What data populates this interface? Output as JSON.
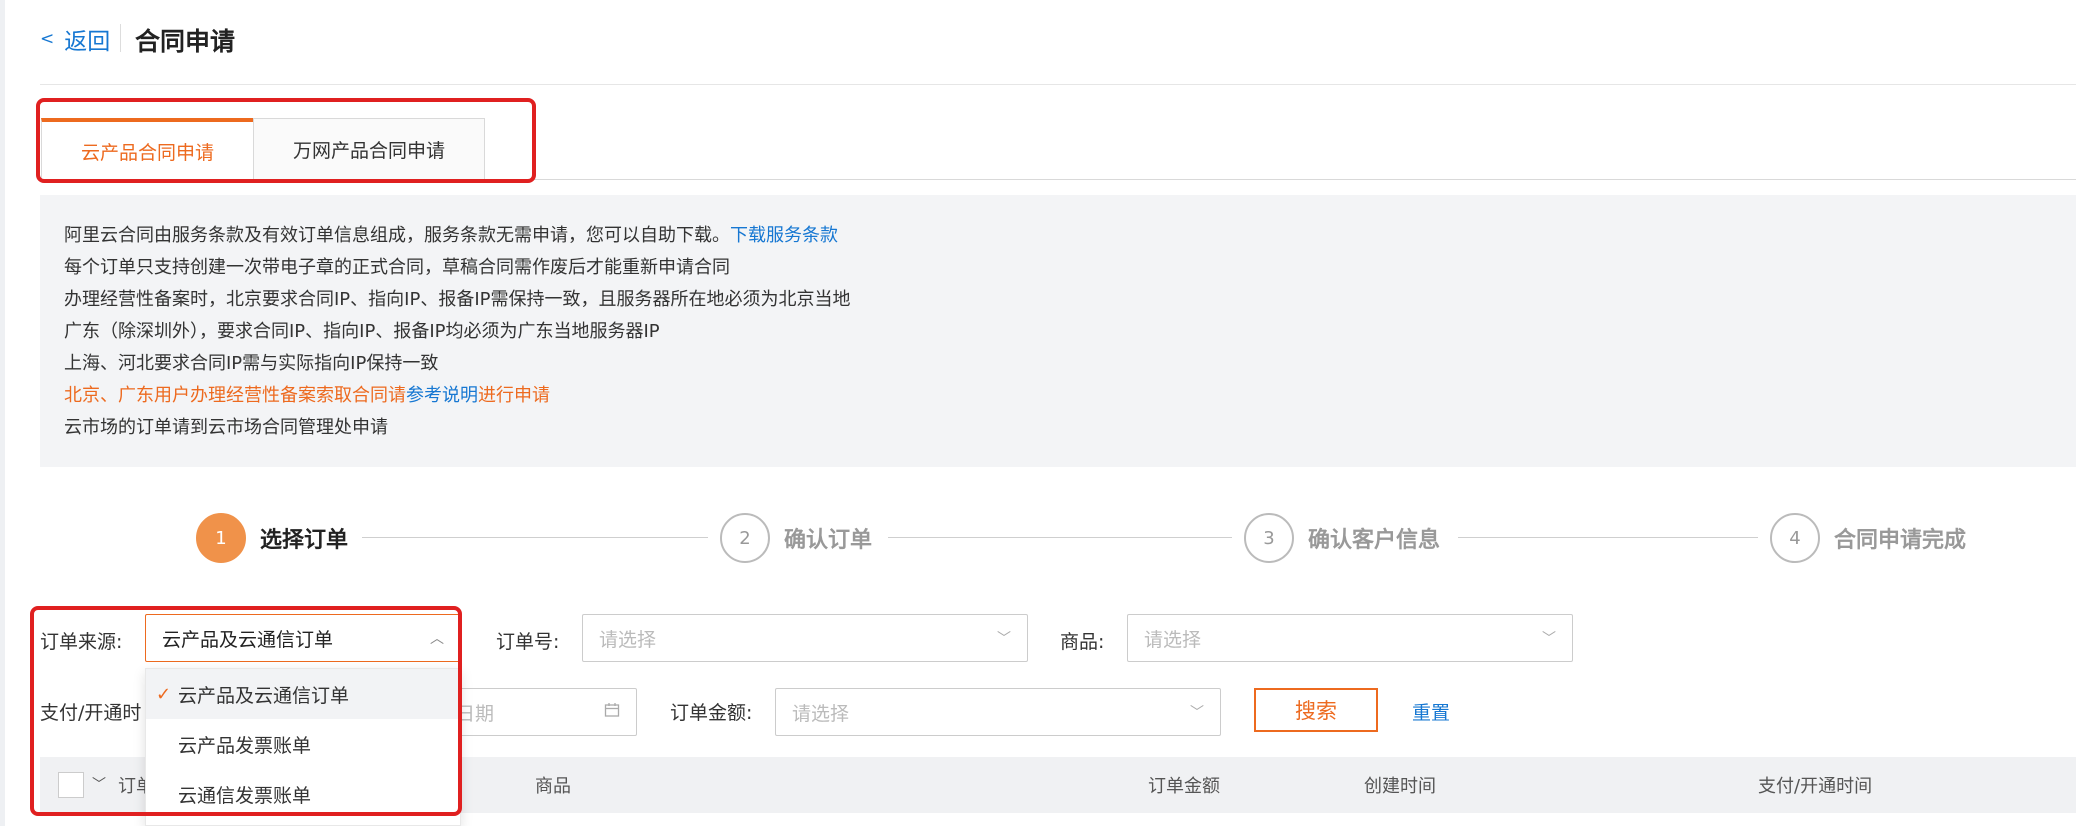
{
  "header": {
    "back_label": "返回",
    "title": "合同申请"
  },
  "tabs": [
    {
      "label": "云产品合同申请",
      "active": true
    },
    {
      "label": "万网产品合同申请",
      "active": false
    }
  ],
  "info": {
    "line1": "阿里云合同由服务条款及有效订单信息组成，服务条款无需申请，您可以自助下载。",
    "line1_link": "下载服务条款",
    "line2": "每个订单只支持创建一次带电子章的正式合同，草稿合同需作废后才能重新申请合同",
    "line3": "办理经营性备案时，北京要求合同IP、指向IP、报备IP需保持一致，且服务器所在地必须为北京当地",
    "line4": "广东（除深圳外），要求合同IP、指向IP、报备IP均必须为广东当地服务器IP",
    "line5": "上海、河北要求合同IP需与实际指向IP保持一致",
    "line6_pre": "北京、广东用户办理经营性备案索取合同请",
    "line6_link": "参考说明",
    "line6_post": "进行申请",
    "line7": "云市场的订单请到云市场合同管理处申请"
  },
  "steps": [
    {
      "num": "1",
      "label": "选择订单",
      "active": true
    },
    {
      "num": "2",
      "label": "确认订单",
      "active": false
    },
    {
      "num": "3",
      "label": "确认客户信息",
      "active": false
    },
    {
      "num": "4",
      "label": "合同申请完成",
      "active": false
    }
  ],
  "filters": {
    "order_source_label": "订单来源:",
    "order_source_value": "云产品及云通信订单",
    "order_no_label": "订单号:",
    "order_no_placeholder": "请选择",
    "product_label": "商品:",
    "product_placeholder": "请选择",
    "pay_time_label": "支付/开通时",
    "date_placeholder": "日期",
    "amount_label": "订单金额:",
    "amount_placeholder": "请选择",
    "search_label": "搜索",
    "reset_label": "重置"
  },
  "dropdown_options": [
    {
      "label": "云产品及云通信订单",
      "selected": true
    },
    {
      "label": "云产品发票账单",
      "selected": false
    },
    {
      "label": "云通信发票账单",
      "selected": false
    }
  ],
  "table": {
    "headers": [
      "订单",
      "商品",
      "订单金额",
      "创建时间",
      "支付/开通时间"
    ]
  },
  "colors": {
    "accent": "#ed6a1f",
    "link": "#1677d2",
    "highlight": "#e02020"
  },
  "icons": [
    "chevron-left-icon",
    "chevron-down-icon",
    "chevron-up-icon",
    "calendar-icon",
    "check-icon"
  ]
}
